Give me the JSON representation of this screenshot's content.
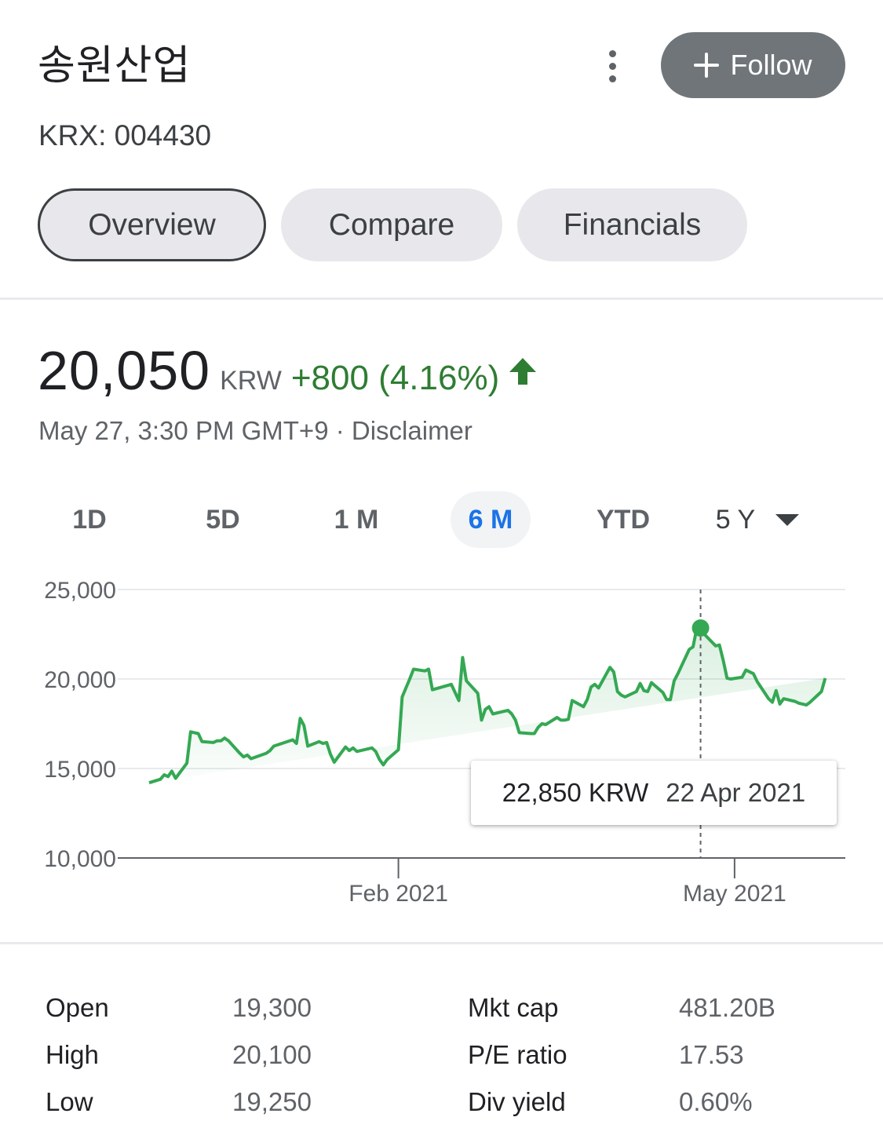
{
  "header": {
    "company_name": "송원산업",
    "ticker": "KRX: 004430",
    "more_icon": "more-vert-icon",
    "follow_label": "Follow",
    "follow_icon": "plus-icon"
  },
  "tabs": [
    {
      "label": "Overview",
      "active": true
    },
    {
      "label": "Compare",
      "active": false
    },
    {
      "label": "Financials",
      "active": false
    }
  ],
  "quote": {
    "price": "20,050",
    "currency": "KRW",
    "change": "+800 (4.16%)",
    "direction_icon": "arrow-up-icon",
    "timestamp": "May 27, 3:30 PM GMT+9 · Disclaimer"
  },
  "ranges": [
    {
      "label": "1D",
      "active": false
    },
    {
      "label": "5D",
      "active": false
    },
    {
      "label": "1 M",
      "active": false
    },
    {
      "label": "6 M",
      "active": true
    },
    {
      "label": "YTD",
      "active": false
    },
    {
      "label": "5 Y",
      "active": false,
      "has_dropdown": true
    }
  ],
  "colors": {
    "positive": "#34a853",
    "positive_text": "#2e7d32",
    "active_range": "#1a73e8",
    "follow_bg": "#70757a"
  },
  "chart_data": {
    "type": "area",
    "y_ticks": [
      "25,000",
      "20,000",
      "15,000",
      "10,000"
    ],
    "ylim": [
      10000,
      25000
    ],
    "x_ticks": [
      "Feb 2021",
      "May 2021"
    ],
    "x_tick_dates": [
      "2021-02-01",
      "2021-05-01"
    ],
    "grid": true,
    "x": [
      "2020-11-27",
      "2020-11-30",
      "2020-12-01",
      "2020-12-02",
      "2020-12-03",
      "2020-12-04",
      "2020-12-07",
      "2020-12-08",
      "2020-12-09",
      "2020-12-10",
      "2020-12-11",
      "2020-12-14",
      "2020-12-15",
      "2020-12-16",
      "2020-12-17",
      "2020-12-18",
      "2020-12-21",
      "2020-12-22",
      "2020-12-23",
      "2020-12-24",
      "2020-12-28",
      "2020-12-29",
      "2020-12-30",
      "2021-01-04",
      "2021-01-05",
      "2021-01-06",
      "2021-01-07",
      "2021-01-08",
      "2021-01-11",
      "2021-01-12",
      "2021-01-13",
      "2021-01-14",
      "2021-01-15",
      "2021-01-18",
      "2021-01-19",
      "2021-01-20",
      "2021-01-21",
      "2021-01-22",
      "2021-01-25",
      "2021-01-26",
      "2021-01-27",
      "2021-01-28",
      "2021-01-29",
      "2021-02-01",
      "2021-02-02",
      "2021-02-03",
      "2021-02-04",
      "2021-02-05",
      "2021-02-08",
      "2021-02-09",
      "2021-02-10",
      "2021-02-15",
      "2021-02-16",
      "2021-02-17",
      "2021-02-18",
      "2021-02-19",
      "2021-02-22",
      "2021-02-23",
      "2021-02-24",
      "2021-02-25",
      "2021-02-26",
      "2021-03-02",
      "2021-03-03",
      "2021-03-04",
      "2021-03-05",
      "2021-03-08",
      "2021-03-09",
      "2021-03-10",
      "2021-03-11",
      "2021-03-12",
      "2021-03-15",
      "2021-03-16",
      "2021-03-17",
      "2021-03-18",
      "2021-03-19",
      "2021-03-22",
      "2021-03-23",
      "2021-03-24",
      "2021-03-25",
      "2021-03-26",
      "2021-03-29",
      "2021-03-30",
      "2021-03-31",
      "2021-04-01",
      "2021-04-02",
      "2021-04-05",
      "2021-04-06",
      "2021-04-07",
      "2021-04-08",
      "2021-04-09",
      "2021-04-12",
      "2021-04-13",
      "2021-04-14",
      "2021-04-15",
      "2021-04-16",
      "2021-04-19",
      "2021-04-20",
      "2021-04-21",
      "2021-04-22",
      "2021-04-23",
      "2021-04-26",
      "2021-04-27",
      "2021-04-28",
      "2021-04-29",
      "2021-04-30",
      "2021-05-03",
      "2021-05-04",
      "2021-05-06",
      "2021-05-07",
      "2021-05-10",
      "2021-05-11",
      "2021-05-12",
      "2021-05-13",
      "2021-05-14",
      "2021-05-17",
      "2021-05-18",
      "2021-05-20",
      "2021-05-21",
      "2021-05-24",
      "2021-05-25",
      "2021-05-26",
      "2021-05-27"
    ],
    "values": [
      14200,
      14400,
      14650,
      14550,
      14850,
      14450,
      15300,
      17050,
      17000,
      16950,
      16500,
      16450,
      16550,
      16550,
      16700,
      16550,
      15850,
      15650,
      15750,
      15550,
      15850,
      16000,
      16250,
      16600,
      16400,
      17800,
      17400,
      16250,
      16500,
      16400,
      16450,
      15800,
      15350,
      16200,
      16000,
      16150,
      15950,
      16000,
      16150,
      15950,
      15500,
      15200,
      15500,
      16050,
      19000,
      19500,
      20000,
      20550,
      20450,
      20550,
      19400,
      19700,
      19250,
      18800,
      21200,
      19900,
      19200,
      17700,
      18300,
      18450,
      18050,
      18250,
      18050,
      17700,
      17000,
      16950,
      16950,
      17300,
      17500,
      17450,
      17850,
      17700,
      17700,
      17750,
      18800,
      18450,
      18850,
      19550,
      19700,
      19500,
      20650,
      20400,
      19300,
      19100,
      19000,
      19300,
      19750,
      19350,
      19300,
      19800,
      19250,
      18850,
      18850,
      19900,
      20300,
      21650,
      21800,
      22850,
      22900,
      22500,
      21850,
      21900,
      21050,
      20050,
      20000,
      20100,
      20500,
      20300,
      19850,
      18900,
      18700,
      19350,
      18600,
      18900,
      18750,
      18650,
      18550,
      18700,
      19300,
      20050
    ],
    "highlight": {
      "value": "22,850 KRW",
      "date": "22 Apr 2021",
      "x": "2021-04-22",
      "y": 22850
    }
  },
  "stats": {
    "left": [
      {
        "label": "Open",
        "value": "19,300"
      },
      {
        "label": "High",
        "value": "20,100"
      },
      {
        "label": "Low",
        "value": "19,250"
      }
    ],
    "right": [
      {
        "label": "Mkt cap",
        "value": "481.20B"
      },
      {
        "label": "P/E ratio",
        "value": "17.53"
      },
      {
        "label": "Div yield",
        "value": "0.60%"
      }
    ]
  }
}
